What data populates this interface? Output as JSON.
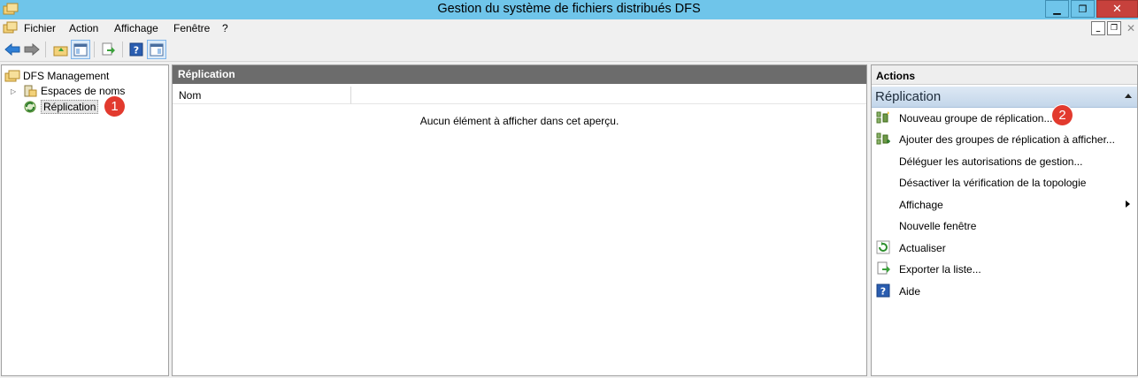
{
  "window": {
    "title": "Gestion du système de fichiers distribués DFS",
    "min_glyph": "▁",
    "max_glyph": "❐",
    "close_glyph": "✕"
  },
  "menu": {
    "items": [
      "Fichier",
      "Action",
      "Affichage",
      "Fenêtre",
      "?"
    ],
    "mdi_min": "_",
    "mdi_restore": "❐",
    "mdi_close": "✕"
  },
  "toolbar": {
    "buttons": [
      "back-arrow-icon",
      "forward-arrow-icon",
      "up-folder-icon",
      "show-hide-console-tree-icon",
      "export-list-icon",
      "help-icon",
      "show-hide-action-pane-icon"
    ]
  },
  "tree": {
    "root": "DFS Management",
    "items": [
      {
        "label": "Espaces de noms",
        "expandable": true
      },
      {
        "label": "Réplication",
        "selected": true
      }
    ]
  },
  "center": {
    "header": "Réplication",
    "column": "Nom",
    "empty_message": "Aucun élément à afficher dans cet aperçu."
  },
  "actions": {
    "header": "Actions",
    "section": "Réplication",
    "items": [
      {
        "label": "Nouveau groupe de réplication...",
        "icon": "new-replication-group-icon"
      },
      {
        "label": "Ajouter des groupes de réplication à afficher...",
        "icon": "add-replication-groups-icon"
      },
      {
        "label": "Déléguer les autorisations de gestion...",
        "icon": ""
      },
      {
        "label": "Désactiver la vérification de la topologie",
        "icon": ""
      },
      {
        "label": "Affichage",
        "icon": "",
        "submenu": true
      },
      {
        "label": "Nouvelle fenêtre",
        "icon": ""
      },
      {
        "label": "Actualiser",
        "icon": "refresh-icon"
      },
      {
        "label": "Exporter la liste...",
        "icon": "export-list-icon"
      },
      {
        "label": "Aide",
        "icon": "help-icon"
      }
    ]
  },
  "badges": {
    "one": "1",
    "two": "2"
  },
  "colors": {
    "titlebar": "#6fc5ea",
    "close_button": "#c7413c",
    "badge": "#e23a2e",
    "pane_header": "#6c6c6c",
    "actions_section": "#c3d6ea"
  }
}
